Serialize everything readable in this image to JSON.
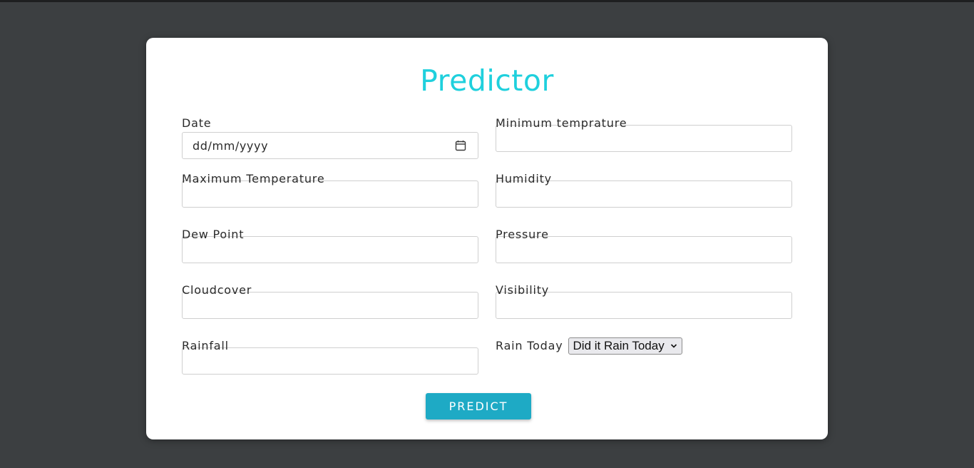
{
  "form": {
    "title": "Predictor",
    "fields": {
      "date": {
        "label": "Date",
        "placeholder": "dd/mm/yyyy"
      },
      "min_temp": {
        "label": "Minimum temprature",
        "value": ""
      },
      "max_temp": {
        "label": "Maximum Temperature",
        "value": ""
      },
      "humidity": {
        "label": "Humidity",
        "value": ""
      },
      "dew_point": {
        "label": "Dew Point",
        "value": ""
      },
      "pressure": {
        "label": "Pressure",
        "value": ""
      },
      "cloudcover": {
        "label": "Cloudcover",
        "value": ""
      },
      "visibility": {
        "label": "Visibility",
        "value": ""
      },
      "rainfall": {
        "label": "Rainfall",
        "value": ""
      }
    },
    "rain_today": {
      "label": "Rain Today",
      "selected": "Did it Rain Today"
    },
    "submit_label": "PREDICT"
  },
  "colors": {
    "title": "#1fd0dd",
    "button": "#1eaac5",
    "background": "#3c3f41"
  },
  "icons": {
    "date": "calendar-icon",
    "select": "chevron-down-icon"
  }
}
